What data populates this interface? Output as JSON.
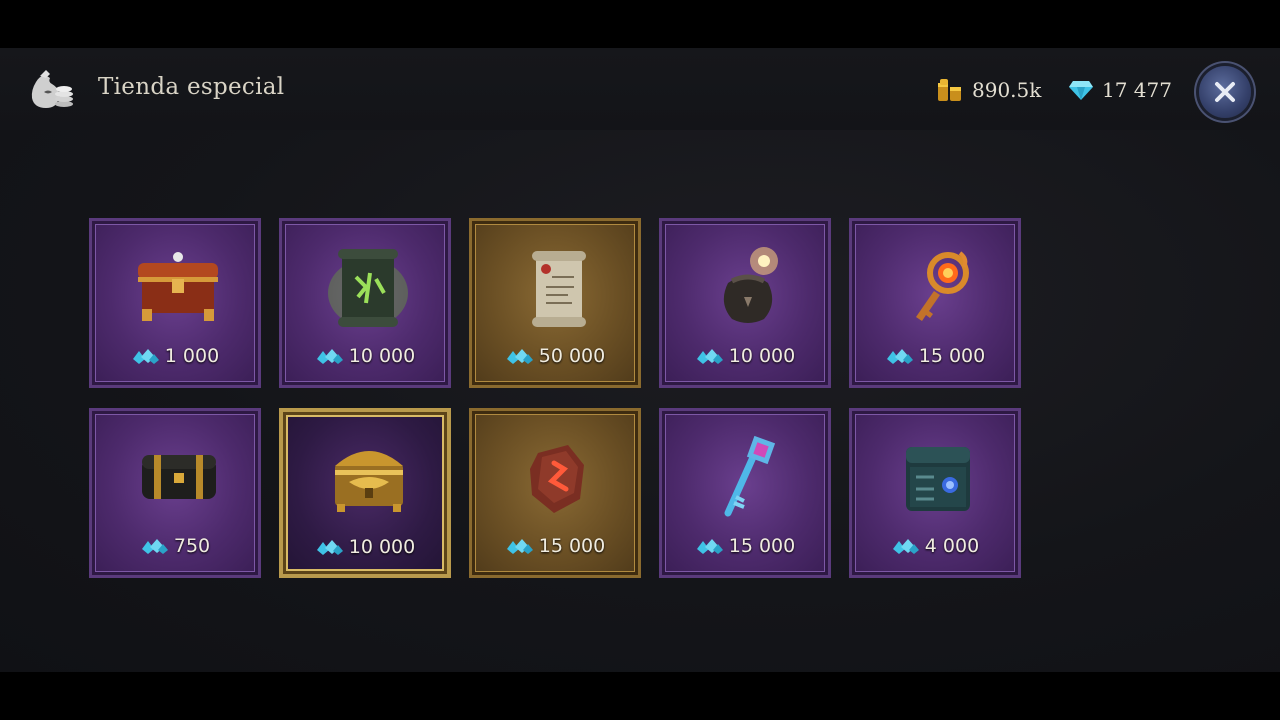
{
  "header": {
    "title": "Tienda especial",
    "gold_amount": "890.5k",
    "gems_amount": "17 477"
  },
  "items": [
    {
      "price": "1 000",
      "icon": "red-chest-icon",
      "style": "purple"
    },
    {
      "price": "10 000",
      "icon": "green-scroll-icon",
      "style": "purple"
    },
    {
      "price": "50 000",
      "icon": "parchment-scroll-icon",
      "style": "gold"
    },
    {
      "price": "10 000",
      "icon": "glowing-pouch-icon",
      "style": "purple"
    },
    {
      "price": "15 000",
      "icon": "fire-key-icon",
      "style": "purple"
    },
    {
      "price": "750",
      "icon": "black-chest-icon",
      "style": "purple"
    },
    {
      "price": "10 000",
      "icon": "golden-chest-icon",
      "style": "highlight"
    },
    {
      "price": "15 000",
      "icon": "rune-stone-icon",
      "style": "gold"
    },
    {
      "price": "15 000",
      "icon": "crystal-key-icon",
      "style": "purple"
    },
    {
      "price": "4 000",
      "icon": "teal-chest-icon",
      "style": "purple"
    }
  ],
  "colors": {
    "tile_purple": "#4d2a6c",
    "tile_gold": "#6a4f24",
    "gem_blue": "#3fc3e6",
    "close_button": "#34406a"
  }
}
